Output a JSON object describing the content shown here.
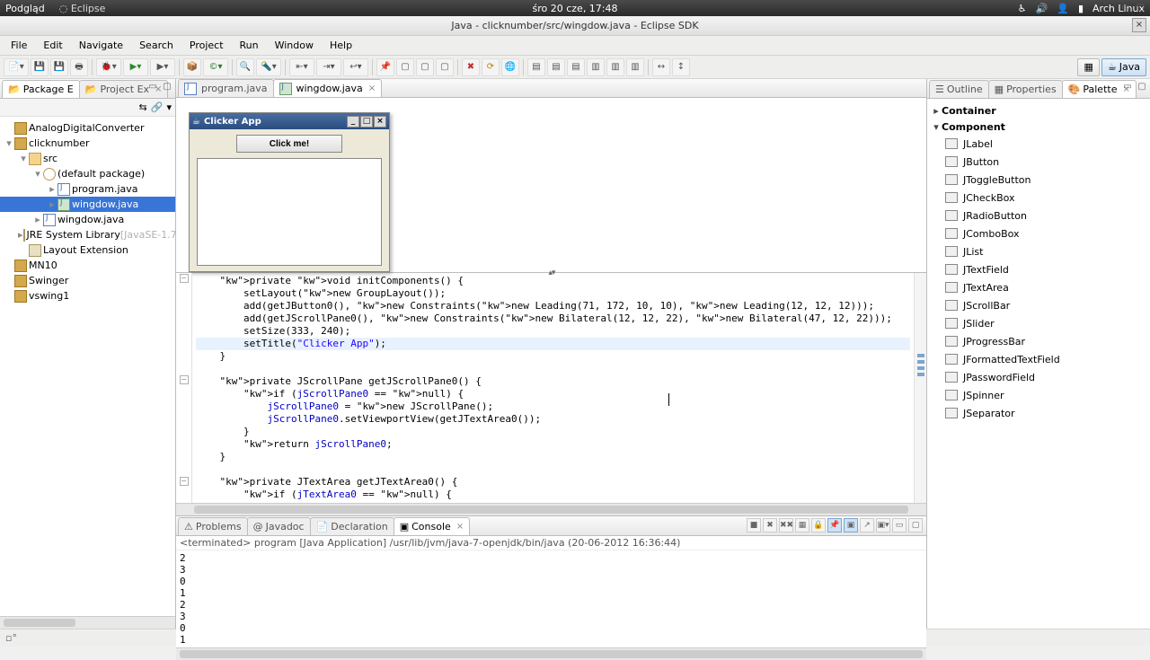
{
  "os": {
    "left_items": [
      "Podgląd"
    ],
    "eclipse_logo": "◌ Eclipse",
    "clock": "śro 20 cze, 17:48",
    "distro": "Arch Linux"
  },
  "window_title": "Java - clicknumber/src/wingdow.java - Eclipse SDK",
  "menu": [
    "File",
    "Edit",
    "Navigate",
    "Search",
    "Project",
    "Run",
    "Window",
    "Help"
  ],
  "perspective_active": "Java",
  "left_view_tabs": [
    {
      "label": "Package E",
      "active": true
    },
    {
      "label": "Project Ex",
      "active": false
    }
  ],
  "tree": [
    {
      "d": 0,
      "tw": "",
      "icon": "prj",
      "label": "AnalogDigitalConverter"
    },
    {
      "d": 0,
      "tw": "▾",
      "icon": "prj",
      "label": "clicknumber"
    },
    {
      "d": 1,
      "tw": "▾",
      "icon": "fld",
      "label": "src"
    },
    {
      "d": 2,
      "tw": "▾",
      "icon": "pkg",
      "label": "(default package)"
    },
    {
      "d": 3,
      "tw": "▸",
      "icon": "java",
      "label": "program.java"
    },
    {
      "d": 3,
      "tw": "▸",
      "icon": "javad",
      "label": "wingdow.java",
      "sel": true
    },
    {
      "d": 2,
      "tw": "▸",
      "icon": "java",
      "label": "wingdow.java"
    },
    {
      "d": 1,
      "tw": "▸",
      "icon": "lib",
      "label": "JRE System Library",
      "suffix": " [JavaSE-1.7]"
    },
    {
      "d": 1,
      "tw": "",
      "icon": "lib",
      "label": "Layout Extension"
    },
    {
      "d": 0,
      "tw": "",
      "icon": "prj",
      "label": "MN10"
    },
    {
      "d": 0,
      "tw": "",
      "icon": "prj",
      "label": "Swinger"
    },
    {
      "d": 0,
      "tw": "",
      "icon": "prj",
      "label": "vswing1"
    }
  ],
  "editor_tabs": [
    {
      "label": "program.java",
      "active": false
    },
    {
      "label": "wingdow.java",
      "active": true
    }
  ],
  "mock": {
    "title": "Clicker App",
    "button": "Click me!"
  },
  "code_lines": [
    {
      "t": "    private void initComponents() {",
      "f": "minus",
      "cls": ""
    },
    {
      "t": "        setLayout(new GroupLayout());",
      "cls": ""
    },
    {
      "t": "        add(getJButton0(), new Constraints(new Leading(71, 172, 10, 10), new Leading(12, 12, 12)));",
      "cls": ""
    },
    {
      "t": "        add(getJScrollPane0(), new Constraints(new Bilateral(12, 12, 22), new Bilateral(47, 12, 22)));",
      "cls": ""
    },
    {
      "t": "        setSize(333, 240);",
      "cls": ""
    },
    {
      "t": "        setTitle(\"Clicker App\");",
      "cls": "hl"
    },
    {
      "t": "    }",
      "cls": ""
    },
    {
      "t": "",
      "cls": ""
    },
    {
      "t": "    private JScrollPane getJScrollPane0() {",
      "f": "minus",
      "cls": ""
    },
    {
      "t": "        if (jScrollPane0 == null) {",
      "cls": ""
    },
    {
      "t": "            jScrollPane0 = new JScrollPane();",
      "cls": ""
    },
    {
      "t": "            jScrollPane0.setViewportView(getJTextArea0());",
      "cls": ""
    },
    {
      "t": "        }",
      "cls": ""
    },
    {
      "t": "        return jScrollPane0;",
      "cls": ""
    },
    {
      "t": "    }",
      "cls": ""
    },
    {
      "t": "",
      "cls": ""
    },
    {
      "t": "    private JTextArea getJTextArea0() {",
      "f": "minus",
      "cls": ""
    },
    {
      "t": "        if (jTextArea0 == null) {",
      "cls": ""
    }
  ],
  "bottom_tabs": [
    {
      "label": "Problems"
    },
    {
      "label": "Javadoc"
    },
    {
      "label": "Declaration"
    },
    {
      "label": "Console",
      "active": true
    }
  ],
  "console_header": "<terminated> program [Java Application] /usr/lib/jvm/java-7-openjdk/bin/java (20-06-2012 16:36:44)",
  "console_output": "2\n3\n0\n1\n2\n3\n0\n1",
  "right_tabs": [
    {
      "label": "Outline"
    },
    {
      "label": "Properties"
    },
    {
      "label": "Palette",
      "active": true
    }
  ],
  "palette": {
    "categories": [
      {
        "name": "Container",
        "open": false
      },
      {
        "name": "Component",
        "open": true,
        "items": [
          "JLabel",
          "JButton",
          "JToggleButton",
          "JCheckBox",
          "JRadioButton",
          "JComboBox",
          "JList",
          "JTextField",
          "JTextArea",
          "JScrollBar",
          "JSlider",
          "JProgressBar",
          "JFormattedTextField",
          "JPasswordField",
          "JSpinner",
          "JSeparator"
        ]
      }
    ]
  }
}
